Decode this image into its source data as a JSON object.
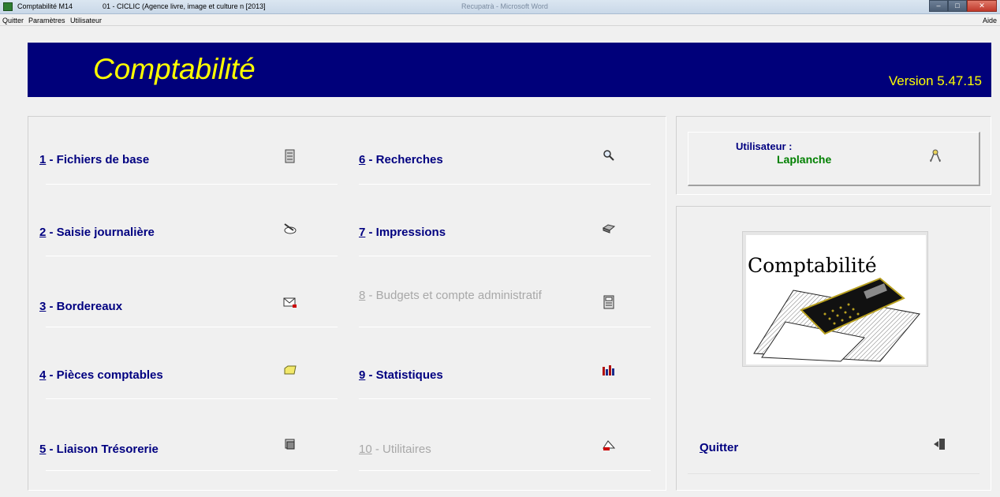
{
  "window": {
    "app_title": "Comptabilité M14",
    "doc_title": "01 - CICLIC (Agence livre, image et culture n  [2013]",
    "background_title": "Recupatrà - Microsoft Word"
  },
  "menubar": {
    "items": [
      "Quitter",
      "Paramètres",
      "Utilisateur"
    ],
    "help": "Aide"
  },
  "banner": {
    "title": "Comptabilité",
    "version": "Version 5.47.15",
    "background_color": "#00007a",
    "text_color": "#ffff00"
  },
  "menu": [
    {
      "num": "1",
      "rest": " - Fichiers de base",
      "icon": "file-cabinet-icon",
      "enabled": true
    },
    {
      "num": "2",
      "rest": " - Saisie journalière",
      "icon": "pencil-writing-icon",
      "enabled": true
    },
    {
      "num": "3",
      "rest": " - Bordereaux",
      "icon": "envelope-icon",
      "enabled": true
    },
    {
      "num": "4",
      "rest": " - Pièces comptables",
      "icon": "folder-icon",
      "enabled": true
    },
    {
      "num": "5",
      "rest": " - Liaison Trésorerie",
      "icon": "printer-stack-icon",
      "enabled": true
    },
    {
      "num": "6",
      "rest": " - Recherches",
      "icon": "magnifier-icon",
      "enabled": true
    },
    {
      "num": "7",
      "rest": " - Impressions",
      "icon": "printer-icon",
      "enabled": true
    },
    {
      "num": "8",
      "rest": " - Budgets et compte administratif",
      "icon": "ledger-icon",
      "enabled": false
    },
    {
      "num": "9",
      "rest": " - Statistiques",
      "icon": "bar-chart-icon",
      "enabled": true
    },
    {
      "num": "10",
      "rest": " - Utilitaires",
      "icon": "toolbox-icon",
      "enabled": false
    }
  ],
  "user": {
    "label": "Utilisateur :",
    "name": "Laplanche",
    "icon": "keys-icon"
  },
  "logo": {
    "text": "Comptabilité",
    "icon": "calculator-icon"
  },
  "quit": {
    "first": "Q",
    "rest": "uitter",
    "icon": "exit-door-icon"
  }
}
